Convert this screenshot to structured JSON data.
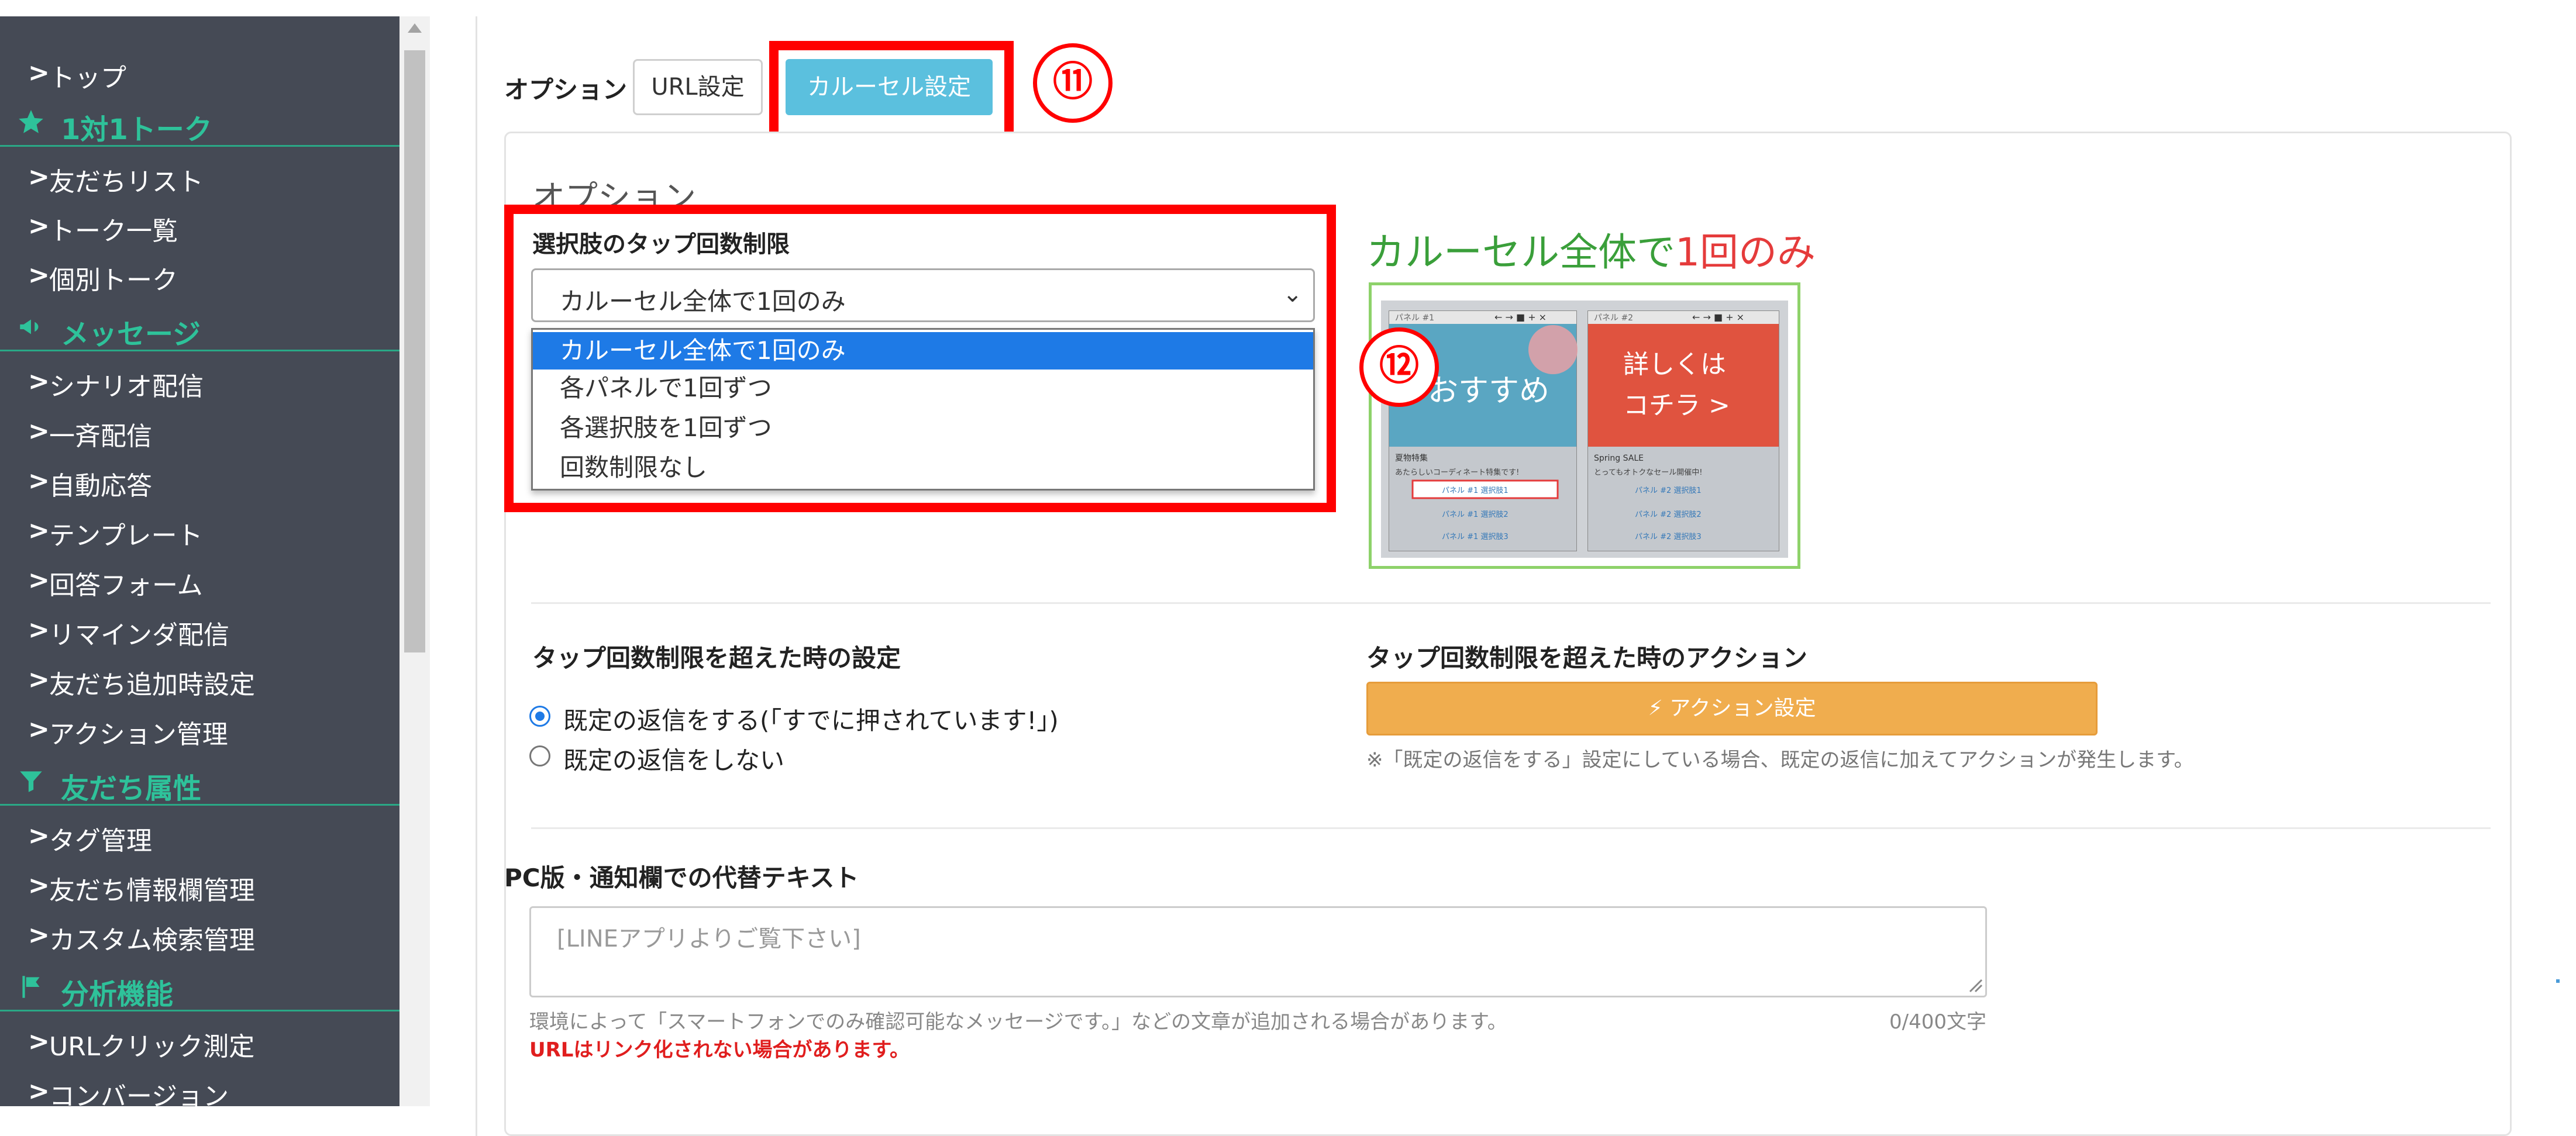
{
  "sidebar": {
    "items": [
      {
        "type": "link",
        "label": "トップ"
      },
      {
        "type": "header",
        "icon": "star-icon",
        "label": "1対1トーク"
      },
      {
        "type": "link",
        "label": "友だちリスト"
      },
      {
        "type": "link",
        "label": "トーク一覧"
      },
      {
        "type": "link",
        "label": "個別トーク"
      },
      {
        "type": "header",
        "icon": "megaphone-icon",
        "label": "メッセージ"
      },
      {
        "type": "link",
        "label": "シナリオ配信"
      },
      {
        "type": "link",
        "label": "一斉配信"
      },
      {
        "type": "link",
        "label": "自動応答"
      },
      {
        "type": "link",
        "label": "テンプレート"
      },
      {
        "type": "link",
        "label": "回答フォーム"
      },
      {
        "type": "link",
        "label": "リマインダ配信"
      },
      {
        "type": "link",
        "label": "友だち追加時設定"
      },
      {
        "type": "link",
        "label": "アクション管理"
      },
      {
        "type": "header",
        "icon": "filter-icon",
        "label": "友だち属性"
      },
      {
        "type": "link",
        "label": "タグ管理"
      },
      {
        "type": "link",
        "label": "友だち情報欄管理"
      },
      {
        "type": "link",
        "label": "カスタム検索管理"
      },
      {
        "type": "header",
        "icon": "flag-icon",
        "label": "分析機能"
      },
      {
        "type": "link",
        "label": "URLクリック測定"
      },
      {
        "type": "link",
        "label": "コンバージョン"
      }
    ]
  },
  "options_bar": {
    "label": "オプション",
    "url_button": "URL設定",
    "carousel_button": "カルーセル設定"
  },
  "callouts": {
    "c11": "⑪",
    "c12": "⑫"
  },
  "panel": {
    "title": "オプション",
    "tap_limit": {
      "label": "選択肢のタップ回数制限",
      "selected": "カルーセル全体で1回のみ",
      "options": [
        "カルーセル全体で1回のみ",
        "各パネルで1回ずつ",
        "各選択肢を1回ずつ",
        "回数制限なし"
      ]
    },
    "preview": {
      "caption_a": "カルーセル全体",
      "caption_b": "で",
      "caption_c": "1回のみ",
      "panel1": {
        "badge": "パネル #1",
        "image_text": "おすすめ",
        "title": "夏物特集",
        "desc": "あたらしいコーディネート特集です!",
        "choices": [
          "パネル #1 選択肢1",
          "パネル #1 選択肢2",
          "パネル #1 選択肢3"
        ]
      },
      "panel2": {
        "badge": "パネル #2",
        "image_text_1": "詳しくは",
        "image_text_2": "コチラ >",
        "title": "Spring SALE",
        "desc": "とってもオトクなセール開催中!",
        "choices": [
          "パネル #2 選択肢1",
          "パネル #2 選択肢2",
          "パネル #2 選択肢3"
        ]
      }
    },
    "over_limit": {
      "label": "タップ回数制限を超えた時の設定",
      "options": [
        "既定の返信をする(「すでに押されています!」)",
        "既定の返信をしない"
      ],
      "selected_index": 0
    },
    "over_limit_action": {
      "label": "タップ回数制限を超えた時のアクション",
      "button": "⚡ アクション設定",
      "note": "※「既定の返信をする」設定にしている場合、既定の返信に加えてアクションが発生します。"
    },
    "alt_text": {
      "label": "PC版・通知欄での代替テキスト",
      "placeholder": "[LINEアプリよりご覧下さい]",
      "hint": "環境によって「スマートフォンでのみ確認可能なメッセージです。」などの文章が追加される場合があります。",
      "count": "0/400文字",
      "warning": "URLはリンク化されない場合があります。"
    }
  },
  "colors": {
    "sidebar_bg": "#454a55",
    "sidebar_accent": "#2ec29a",
    "primary_button": "#5bc0de",
    "action_button": "#f0ad4e",
    "callout_red": "#ff0000",
    "select_highlight": "#1e7ae6"
  }
}
